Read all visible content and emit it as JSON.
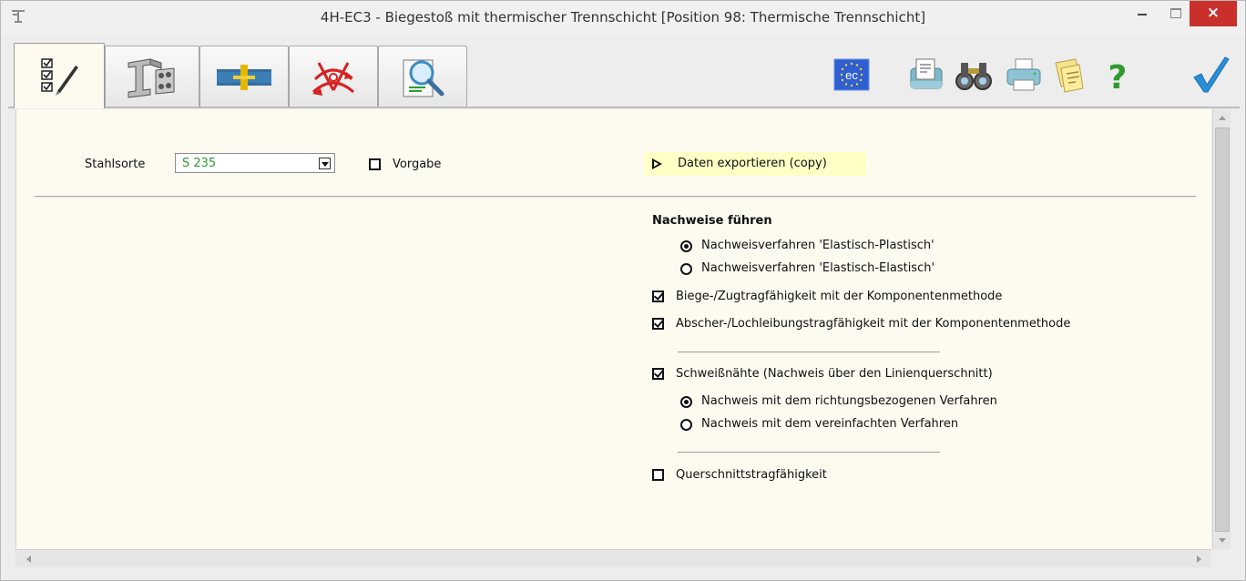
{
  "window": {
    "title": "4H-EC3 - Biegestoß mit thermischer Trennschicht [Position 98: Thermische Trennschicht]",
    "close_glyph": "×"
  },
  "toolbar": {
    "tabs": [
      {
        "name": "tab-input",
        "icon": "checklist-pen-icon",
        "active": true
      },
      {
        "name": "tab-profile",
        "icon": "steel-beam-icon",
        "active": false
      },
      {
        "name": "tab-joint",
        "icon": "splice-plate-icon",
        "active": false
      },
      {
        "name": "tab-load",
        "icon": "load-arrows-icon",
        "active": false
      },
      {
        "name": "tab-results",
        "icon": "magnifier-document-icon",
        "active": false
      }
    ],
    "tools": [
      {
        "name": "eurocode-button",
        "icon": "eu-flag-ec-icon",
        "label": "ec"
      },
      {
        "name": "output-document-button",
        "icon": "document-output-icon"
      },
      {
        "name": "view-button",
        "icon": "binoculars-icon"
      },
      {
        "name": "print-button",
        "icon": "printer-icon"
      },
      {
        "name": "notes-button",
        "icon": "sticky-notes-icon"
      },
      {
        "name": "help-button",
        "icon": "help-question-icon",
        "label": "?"
      },
      {
        "name": "ok-button",
        "icon": "checkmark-icon"
      }
    ]
  },
  "form": {
    "steel_label": "Stahlsorte",
    "steel_value": "S 235",
    "vorgabe_label": "Vorgabe",
    "vorgabe_checked": false,
    "export_label": "Daten exportieren (copy)",
    "section_heading": "Nachweise führen",
    "options": [
      {
        "kind": "radio",
        "checked": true,
        "label": "Nachweisverfahren 'Elastisch-Plastisch'"
      },
      {
        "kind": "radio",
        "checked": false,
        "label": "Nachweisverfahren 'Elastisch-Elastisch'"
      },
      {
        "kind": "checkbox",
        "checked": true,
        "label": "Biege-/Zugtragfähigkeit mit der Komponentenmethode"
      },
      {
        "kind": "checkbox",
        "checked": true,
        "label": "Abscher-/Lochleibungstragfähigkeit mit der Komponentenmethode"
      },
      {
        "kind": "checkbox",
        "checked": true,
        "label": "Schweißnähte (Nachweis über den Linienquerschnitt)"
      },
      {
        "kind": "radio",
        "checked": true,
        "label": "Nachweis mit dem richtungsbezogenen Verfahren"
      },
      {
        "kind": "radio",
        "checked": false,
        "label": "Nachweis mit dem vereinfachten Verfahren"
      },
      {
        "kind": "checkbox",
        "checked": false,
        "label": "Querschnittstragfähigkeit"
      }
    ]
  },
  "colors": {
    "panel_bg": "#fdfaf0",
    "steel_value": "#2e9a2e",
    "export_bg": "#ffffc6",
    "close_button": "#c9302c",
    "ok_check": "#2a8ed8"
  }
}
